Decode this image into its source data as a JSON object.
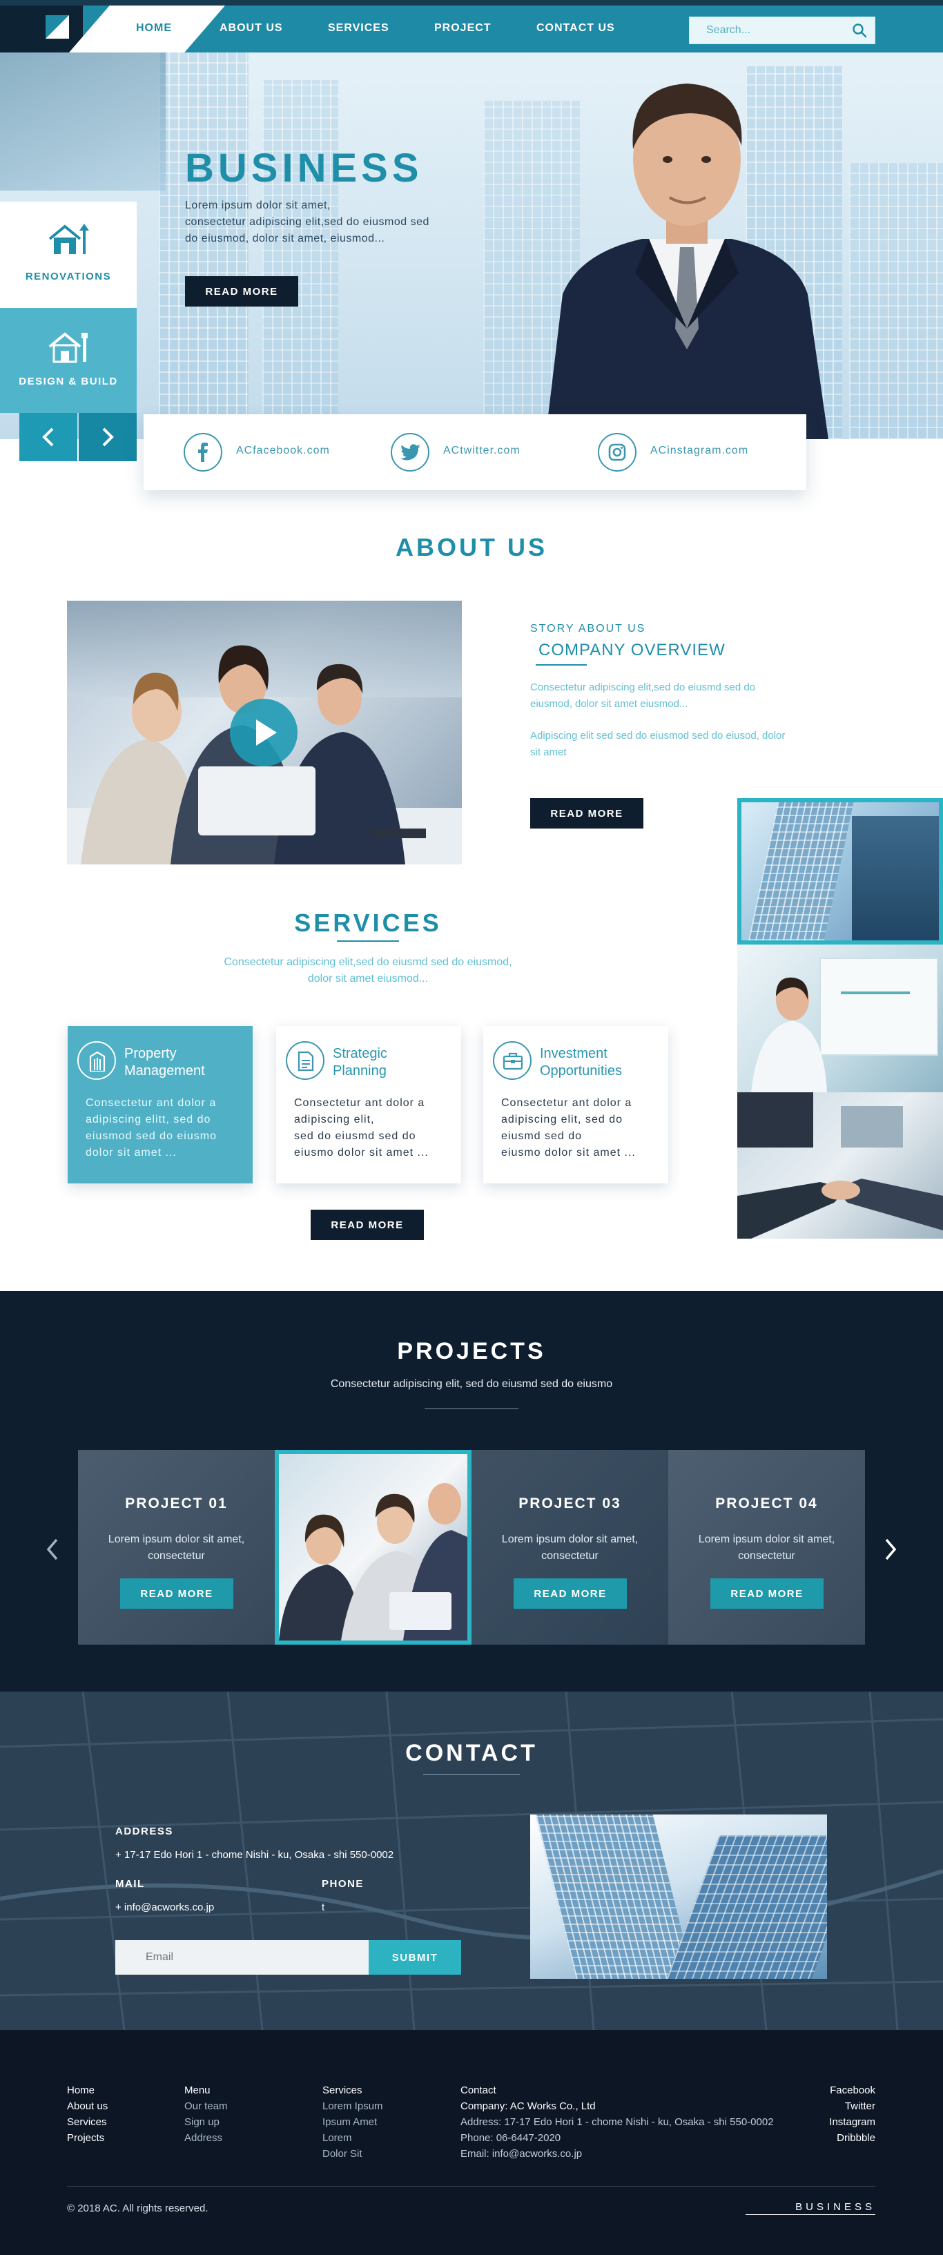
{
  "nav": {
    "items": [
      {
        "label": "HOME"
      },
      {
        "label": "ABOUT US"
      },
      {
        "label": "SERVICES"
      },
      {
        "label": "PROJECT"
      },
      {
        "label": "CONTACT US"
      }
    ],
    "search_placeholder": "Search..."
  },
  "hero": {
    "title": "BUSINESS",
    "desc_lines": [
      "Lorem ipsum dolor sit amet,",
      "consectetur adipiscing elit,sed do eiusmod sed",
      "do eiusmod, dolor sit amet, eiusmod..."
    ],
    "button": "READ MORE"
  },
  "side_menu": {
    "items": [
      {
        "label": "RENOVATIONS",
        "icon": "house-arrow-icon"
      },
      {
        "label": "DESIGN & BUILD",
        "icon": "house-tool-icon"
      }
    ]
  },
  "social": [
    {
      "icon": "facebook-icon",
      "label": "ACfacebook.com"
    },
    {
      "icon": "twitter-icon",
      "label": "ACtwitter.com"
    },
    {
      "icon": "instagram-icon",
      "label": "ACinstagram.com"
    }
  ],
  "about": {
    "title": "ABOUT US",
    "kicker": "STORY ABOUT US",
    "heading": "COMPANY OVERVIEW",
    "para1_lines": [
      "Consectetur adipiscing elit,sed do eiusmd sed do",
      "eiusmod, dolor sit amet eiusmod..."
    ],
    "para2_lines": [
      "Adipiscing elit sed sed do eiusmod sed do eiusod, dolor",
      "sit amet"
    ],
    "button": "READ MORE"
  },
  "services": {
    "title": "SERVICES",
    "sub_lines": [
      "Consectetur adipiscing elit,sed do eiusmd sed do eiusmod,",
      "dolor sit amet eiusmod..."
    ],
    "cards": [
      {
        "title_lines": [
          "Property",
          "Management"
        ],
        "text_lines": [
          "Consectetur ant dolor a",
          "adipiscing elitt, sed do",
          "eiusmod sed do eiusmo",
          "dolor sit amet ..."
        ],
        "icon": "building-icon"
      },
      {
        "title_lines": [
          "Strategic",
          "Planning"
        ],
        "text_lines": [
          "Consectetur ant dolor a",
          "adipiscing elit,",
          "sed do eiusmd sed do",
          "eiusmo dolor sit amet ..."
        ],
        "icon": "document-icon"
      },
      {
        "title_lines": [
          "Investment",
          "Opportunities"
        ],
        "text_lines": [
          "Consectetur ant dolor a",
          "adipiscing elit, sed do",
          "eiusmd sed do",
          "eiusmo dolor sit amet ..."
        ],
        "icon": "briefcase-icon"
      }
    ],
    "button": "READ MORE"
  },
  "projects": {
    "title": "PROJECTS",
    "sub": "Consectetur adipiscing elit, sed do eiusmd sed do eiusmo",
    "items": [
      {
        "title": "PROJECT 01",
        "desc_lines": [
          "Lorem ipsum dolor sit amet,",
          "consectetur"
        ],
        "button": "READ MORE"
      },
      {
        "title": "PROJECT 03",
        "desc_lines": [
          "Lorem ipsum dolor sit amet,",
          "consectetur"
        ],
        "button": "READ MORE"
      },
      {
        "title": "PROJECT 04",
        "desc_lines": [
          "Lorem ipsum dolor sit amet,",
          "consectetur"
        ],
        "button": "READ MORE"
      }
    ]
  },
  "contact": {
    "title": "CONTACT",
    "address_label": "ADDRESS",
    "address": "+ 17-17 Edo Hori 1 - chome Nishi - ku, Osaka - shi 550-0002",
    "mail_label": "MAIL",
    "mail": "+ info@acworks.co.jp",
    "phone_label": "PHONE",
    "phone": "t",
    "email_placeholder": "Email",
    "submit": "SUBMIT"
  },
  "footer": {
    "col1": [
      "Home",
      "About us",
      "Services",
      "Projects"
    ],
    "col2": [
      "Menu",
      "Our team",
      "Sign up",
      "Address"
    ],
    "col3": [
      "Services",
      "Lorem Ipsum",
      "Ipsum Amet",
      "Lorem",
      "Dolor Sit"
    ],
    "col4": [
      "Contact",
      "Company: AC Works Co., Ltd",
      "Address: 17-17 Edo Hori 1 - chome Nishi - ku, Osaka - shi 550-0002",
      "Phone: 06-6447-2020",
      "Email: info@acworks.co.jp"
    ],
    "col5": [
      "Facebook",
      "Twitter",
      "Instagram",
      "Dribbble"
    ],
    "copyright": "© 2018 AC. All rights reserved.",
    "brand": "BUSINESS"
  },
  "colors": {
    "accent": "#1f8ea9",
    "navy": "#0f1e2e",
    "teal_button": "#1f9aab"
  }
}
